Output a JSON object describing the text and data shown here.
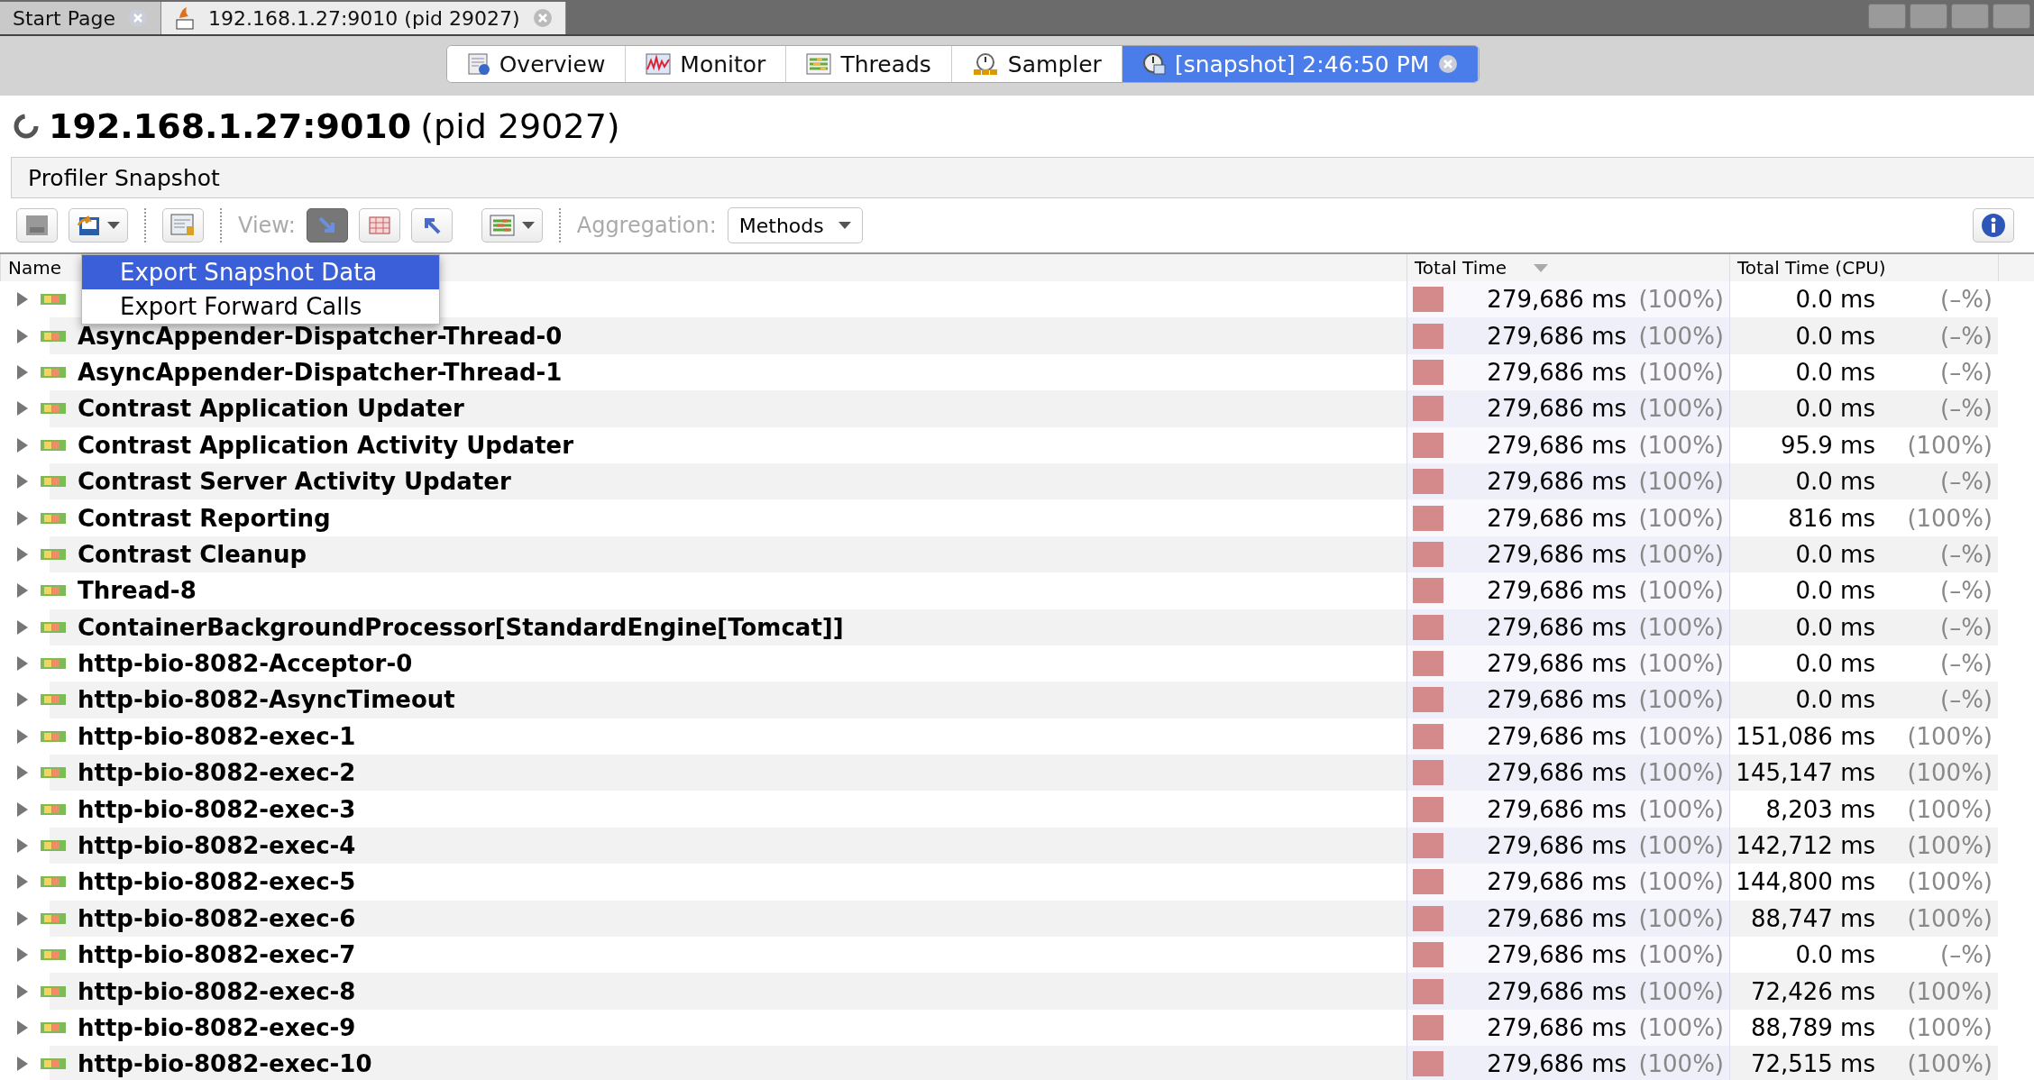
{
  "doc_tabs": [
    {
      "label": "Start Page",
      "selected": false
    },
    {
      "label": "192.168.1.27:9010 (pid 29027)",
      "selected": true
    }
  ],
  "view_tabs": [
    {
      "label": "Overview",
      "kind": "overview",
      "selected": false
    },
    {
      "label": "Monitor",
      "kind": "monitor",
      "selected": false
    },
    {
      "label": "Threads",
      "kind": "threads",
      "selected": false
    },
    {
      "label": "Sampler",
      "kind": "sampler",
      "selected": false
    },
    {
      "label": "[snapshot] 2:46:50 PM",
      "kind": "snapshot",
      "selected": true
    }
  ],
  "title": {
    "host": "192.168.1.27:9010",
    "pid": "(pid 29027)"
  },
  "panel_title": "Profiler Snapshot",
  "toolbar": {
    "view_label": "View:",
    "views": [
      {
        "kind": "forward",
        "selected": true
      },
      {
        "kind": "hotspots",
        "selected": false
      },
      {
        "kind": "reverse",
        "selected": false
      }
    ],
    "aggregation_label": "Aggregation:",
    "aggregation": "Methods"
  },
  "menu": [
    {
      "label": "Export Snapshot Data",
      "selected": true
    },
    {
      "label": "Export Forward Calls",
      "selected": false
    }
  ],
  "columns": [
    "Name",
    "Total Time",
    "Total Time (CPU)"
  ],
  "rows": [
    {
      "expanded": false,
      "total": "279,686 ms",
      "total_pct": "(100%)",
      "level": 1,
      "cpu": "0.0 ms",
      "cpu_pct": "(–%)"
    },
    {
      "name": "AsyncAppender-Dispatcher-Thread-0",
      "expanded": false,
      "total": "279,686 ms",
      "total_pct": "(100%)",
      "level": 1,
      "cpu": "0.0 ms",
      "cpu_pct": "(–%)"
    },
    {
      "name": "AsyncAppender-Dispatcher-Thread-1",
      "expanded": false,
      "total": "279,686 ms",
      "total_pct": "(100%)",
      "level": 1,
      "cpu": "0.0 ms",
      "cpu_pct": "(–%)"
    },
    {
      "name": "Contrast Application Updater",
      "expanded": false,
      "total": "279,686 ms",
      "total_pct": "(100%)",
      "level": 1,
      "cpu": "0.0 ms",
      "cpu_pct": "(–%)"
    },
    {
      "name": "Contrast Application Activity Updater",
      "expanded": false,
      "total": "279,686 ms",
      "total_pct": "(100%)",
      "level": 1,
      "cpu": "95.9 ms",
      "cpu_pct": "(100%)"
    },
    {
      "name": "Contrast Server Activity Updater",
      "expanded": false,
      "total": "279,686 ms",
      "total_pct": "(100%)",
      "level": 1,
      "cpu": "0.0 ms",
      "cpu_pct": "(–%)"
    },
    {
      "name": "Contrast Reporting",
      "expanded": false,
      "total": "279,686 ms",
      "total_pct": "(100%)",
      "level": 1,
      "cpu": "816 ms",
      "cpu_pct": "(100%)"
    },
    {
      "name": "Contrast Cleanup",
      "expanded": false,
      "total": "279,686 ms",
      "total_pct": "(100%)",
      "level": 1,
      "cpu": "0.0 ms",
      "cpu_pct": "(–%)"
    },
    {
      "name": "Thread-8",
      "expanded": false,
      "total": "279,686 ms",
      "total_pct": "(100%)",
      "level": 1,
      "cpu": "0.0 ms",
      "cpu_pct": "(–%)"
    },
    {
      "name": "ContainerBackgroundProcessor[StandardEngine[Tomcat]]",
      "expanded": false,
      "total": "279,686 ms",
      "total_pct": "(100%)",
      "level": 1,
      "cpu": "0.0 ms",
      "cpu_pct": "(–%)"
    },
    {
      "name": "http-bio-8082-Acceptor-0",
      "expanded": false,
      "total": "279,686 ms",
      "total_pct": "(100%)",
      "level": 1,
      "cpu": "0.0 ms",
      "cpu_pct": "(–%)"
    },
    {
      "name": "http-bio-8082-AsyncTimeout",
      "expanded": false,
      "total": "279,686 ms",
      "total_pct": "(100%)",
      "level": 1,
      "cpu": "0.0 ms",
      "cpu_pct": "(–%)"
    },
    {
      "name": "http-bio-8082-exec-1",
      "expanded": false,
      "total": "279,686 ms",
      "total_pct": "(100%)",
      "level": 1,
      "cpu": "151,086 ms",
      "cpu_pct": "(100%)"
    },
    {
      "name": "http-bio-8082-exec-2",
      "expanded": false,
      "total": "279,686 ms",
      "total_pct": "(100%)",
      "level": 1,
      "cpu": "145,147 ms",
      "cpu_pct": "(100%)"
    },
    {
      "name": "http-bio-8082-exec-3",
      "expanded": false,
      "total": "279,686 ms",
      "total_pct": "(100%)",
      "level": 1,
      "cpu": "8,203 ms",
      "cpu_pct": "(100%)"
    },
    {
      "name": "http-bio-8082-exec-4",
      "expanded": false,
      "total": "279,686 ms",
      "total_pct": "(100%)",
      "level": 1,
      "cpu": "142,712 ms",
      "cpu_pct": "(100%)"
    },
    {
      "name": "http-bio-8082-exec-5",
      "expanded": false,
      "total": "279,686 ms",
      "total_pct": "(100%)",
      "level": 1,
      "cpu": "144,800 ms",
      "cpu_pct": "(100%)"
    },
    {
      "name": "http-bio-8082-exec-6",
      "expanded": false,
      "total": "279,686 ms",
      "total_pct": "(100%)",
      "level": 1,
      "cpu": "88,747 ms",
      "cpu_pct": "(100%)"
    },
    {
      "name": "http-bio-8082-exec-7",
      "expanded": false,
      "total": "279,686 ms",
      "total_pct": "(100%)",
      "level": 1,
      "cpu": "0.0 ms",
      "cpu_pct": "(–%)"
    },
    {
      "name": "http-bio-8082-exec-8",
      "expanded": false,
      "total": "279,686 ms",
      "total_pct": "(100%)",
      "level": 1,
      "cpu": "72,426 ms",
      "cpu_pct": "(100%)"
    },
    {
      "name": "http-bio-8082-exec-9",
      "expanded": false,
      "total": "279,686 ms",
      "total_pct": "(100%)",
      "level": 1,
      "cpu": "88,789 ms",
      "cpu_pct": "(100%)"
    },
    {
      "name": "http-bio-8082-exec-10",
      "expanded": false,
      "total": "279,686 ms",
      "total_pct": "(100%)",
      "level": 1,
      "cpu": "72,515 ms",
      "cpu_pct": "(100%)"
    }
  ]
}
